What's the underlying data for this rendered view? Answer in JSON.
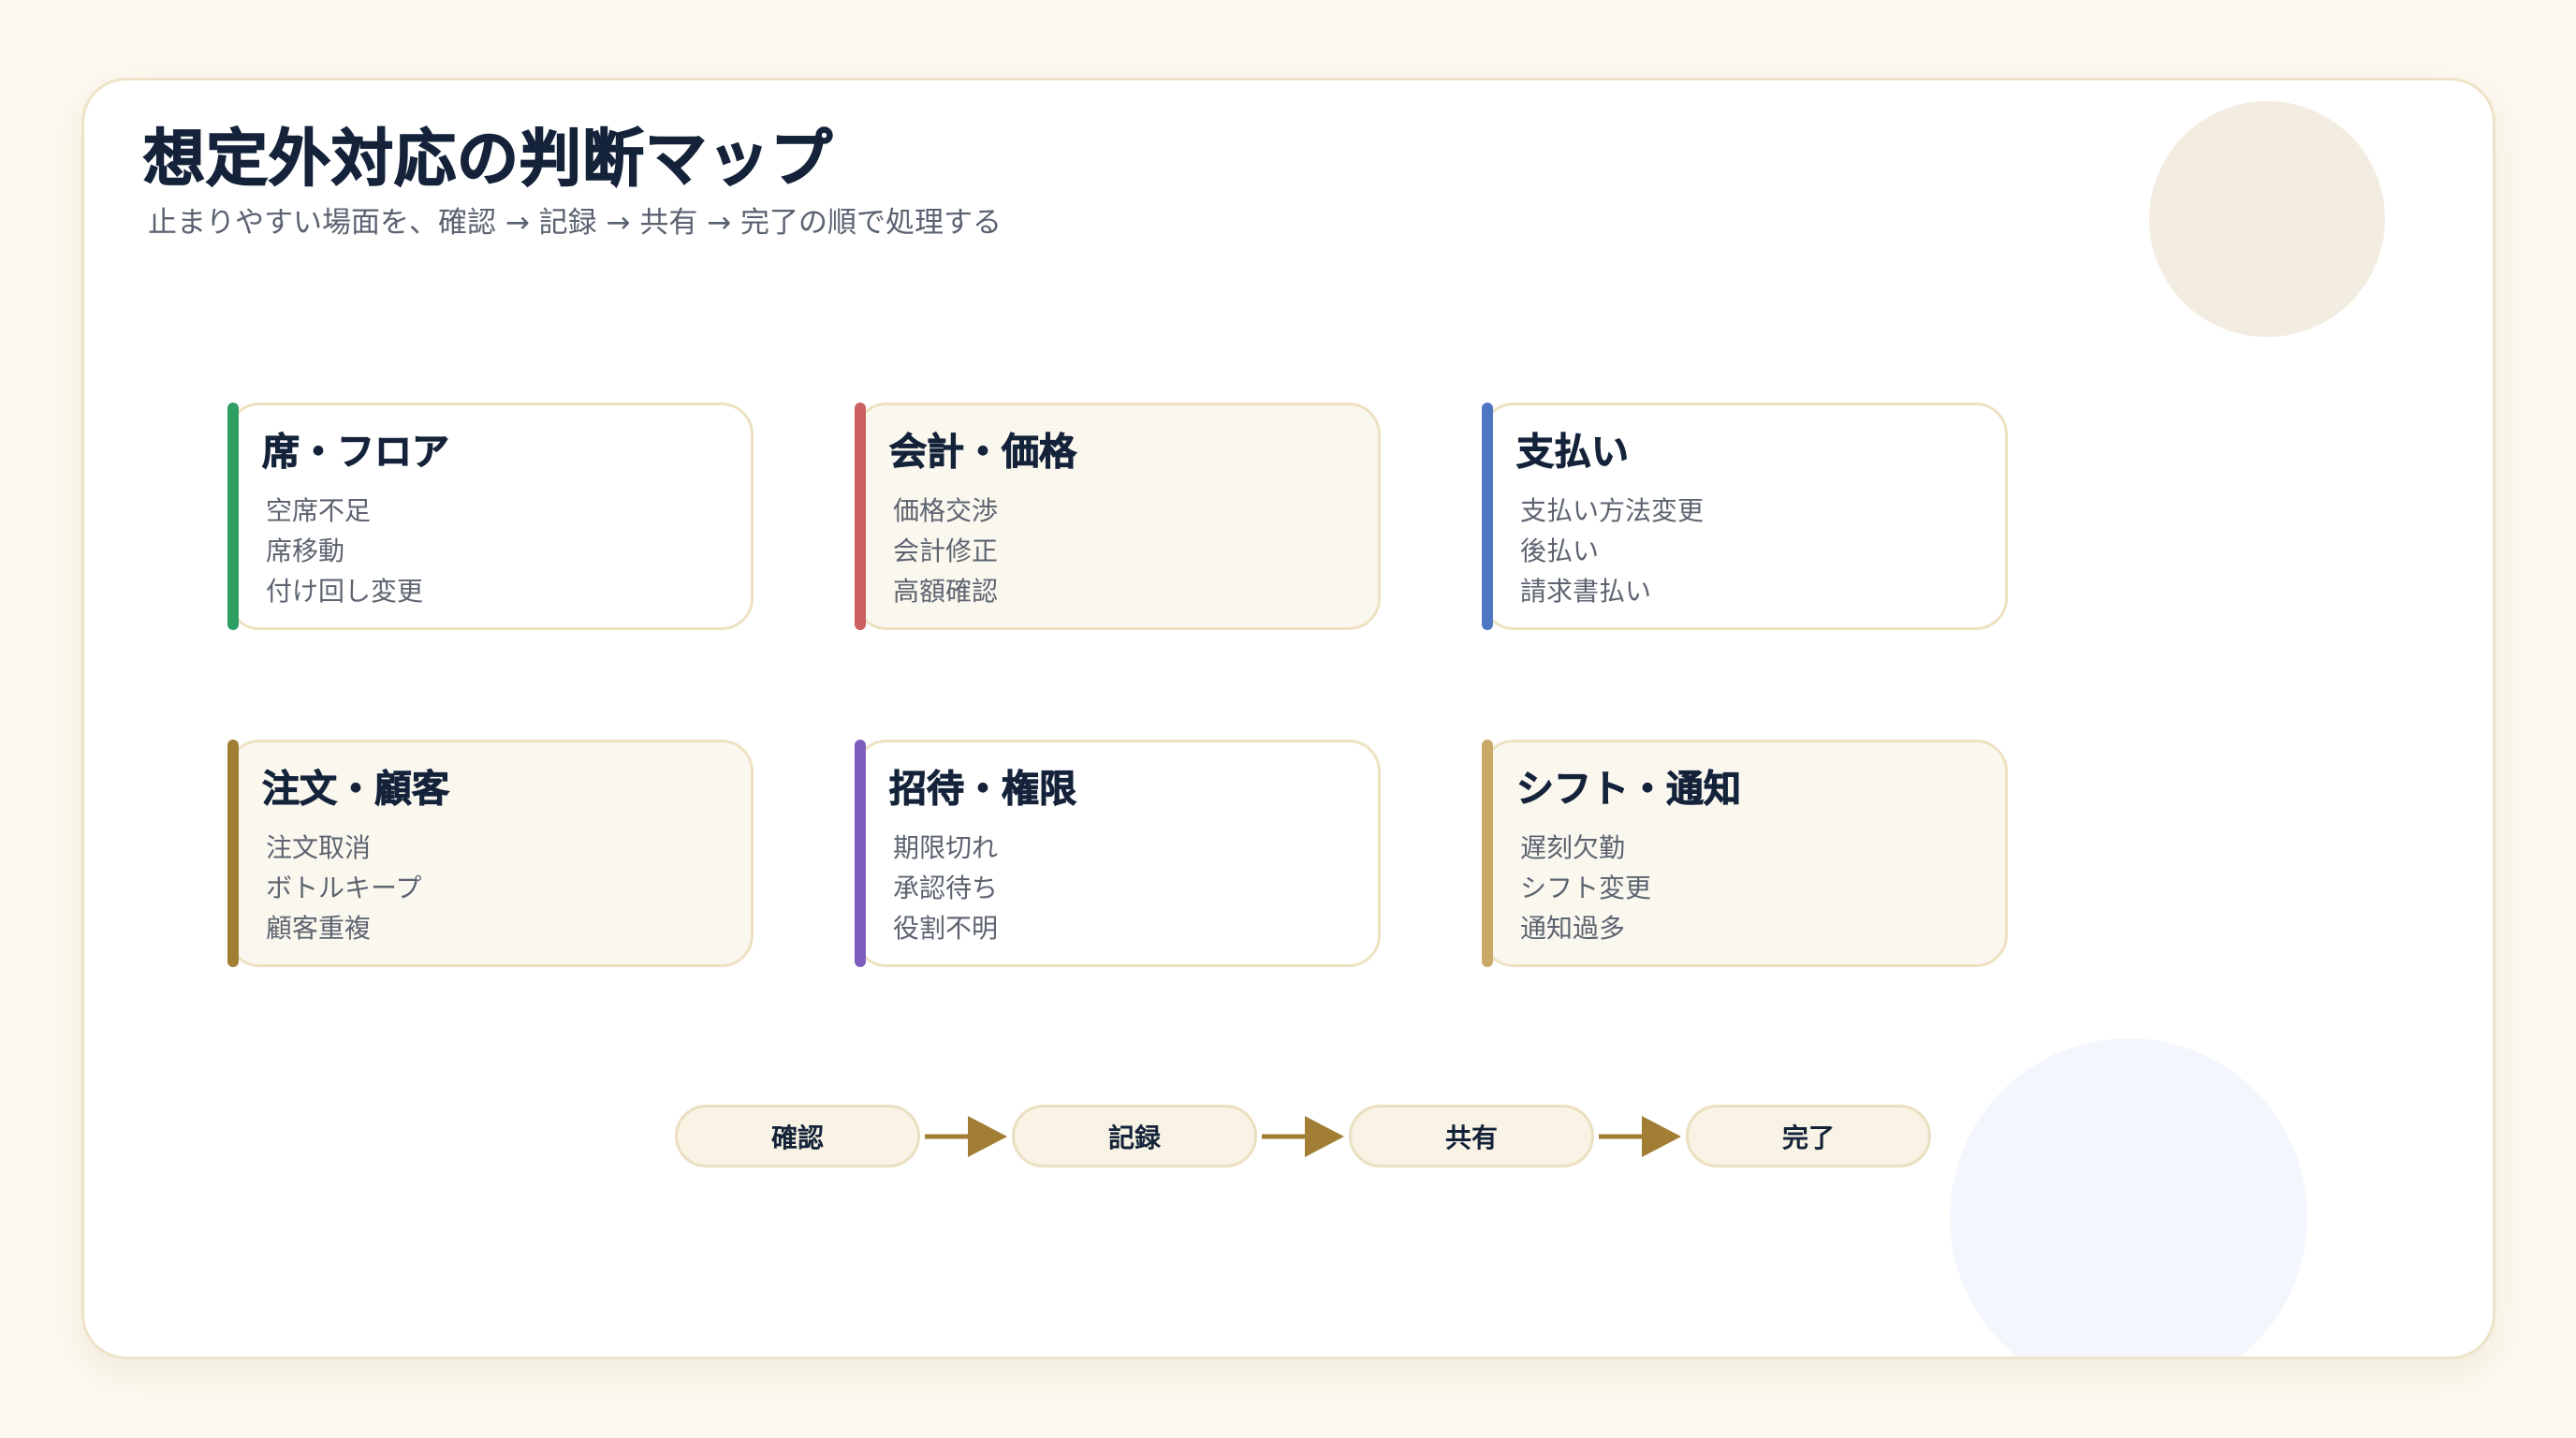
{
  "title": "想定外対応の判断マップ",
  "subtitle": "止まりやすい場面を、確認 → 記録 → 共有 → 完了の順で処理する",
  "cards": [
    {
      "title": "席・フロア",
      "items": [
        "空席不足",
        "席移動",
        "付け回し変更"
      ],
      "accent": "#2e9e63"
    },
    {
      "title": "会計・価格",
      "items": [
        "価格交渉",
        "会計修正",
        "高額確認"
      ],
      "accent": "#cc5f5f"
    },
    {
      "title": "支払い",
      "items": [
        "支払い方法変更",
        "後払い",
        "請求書払い"
      ],
      "accent": "#4f76c2"
    },
    {
      "title": "注文・顧客",
      "items": [
        "注文取消",
        "ボトルキープ",
        "顧客重複"
      ],
      "accent": "#a17e33"
    },
    {
      "title": "招待・権限",
      "items": [
        "期限切れ",
        "承認待ち",
        "役割不明"
      ],
      "accent": "#7e5ebd"
    },
    {
      "title": "シフト・通知",
      "items": [
        "遅刻欠勤",
        "シフト変更",
        "通知過多"
      ],
      "accent": "#c8aa66"
    }
  ],
  "steps": [
    "確認",
    "記録",
    "共有",
    "完了"
  ],
  "colors": {
    "arrow": "#a17e33",
    "background": "#fdf9ef",
    "title": "#14233a"
  }
}
